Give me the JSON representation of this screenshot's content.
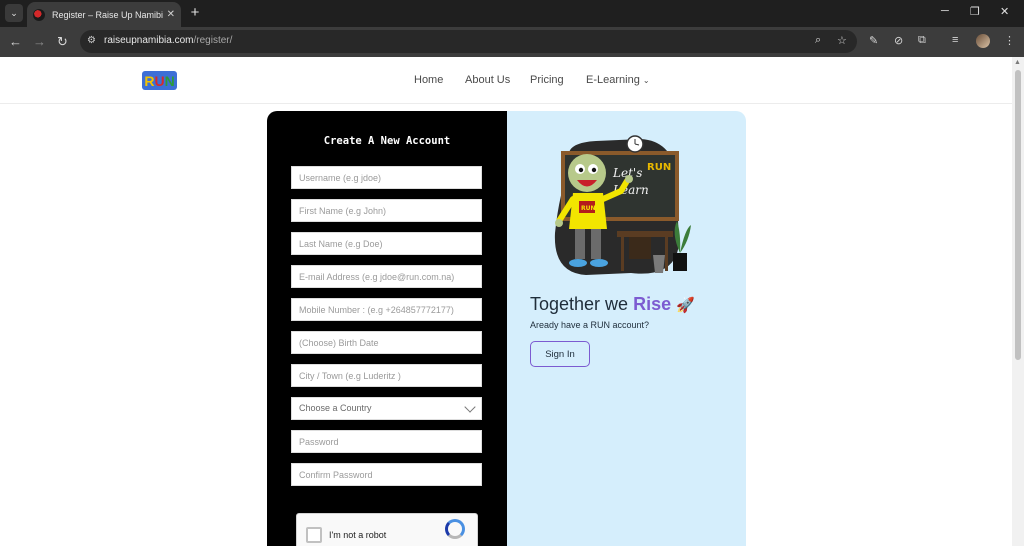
{
  "browser": {
    "tab_title": "Register – Raise Up Namibia",
    "url_host": "raiseupnamibia.com",
    "url_path": "/register/"
  },
  "header": {
    "logo_letters": [
      "R",
      "U",
      "N"
    ],
    "nav": [
      "Home",
      "About Us",
      "Pricing",
      "E-Learning"
    ]
  },
  "form": {
    "title": "Create A New Account",
    "fields": {
      "username": "Username (e.g jdoe)",
      "first_name": "First Name (e.g John)",
      "last_name": "Last Name (e.g Doe)",
      "email": "E-mail Address (e.g jdoe@run.com.na)",
      "mobile": "Mobile Number : (e.g +264857772177)",
      "birth_date": "(Choose) Birth Date",
      "city": "City / Town (e.g Luderitz )",
      "country": "Choose a Country",
      "password": "Password",
      "confirm_password": "Confirm Password"
    },
    "captcha_label": "I'm not a robot"
  },
  "promo": {
    "board_text_1": "Let's",
    "board_run": "RUN",
    "board_text_2": "Learn",
    "shirt_text": "RUN",
    "title_prefix": "Together we",
    "title_highlight": "Rise",
    "subtitle": "Aready have a RUN account?",
    "signin_label": "Sign In"
  },
  "colors": {
    "promo_bg": "#d5eefc",
    "accent": "#7c5bd1",
    "form_bg": "#000000"
  }
}
